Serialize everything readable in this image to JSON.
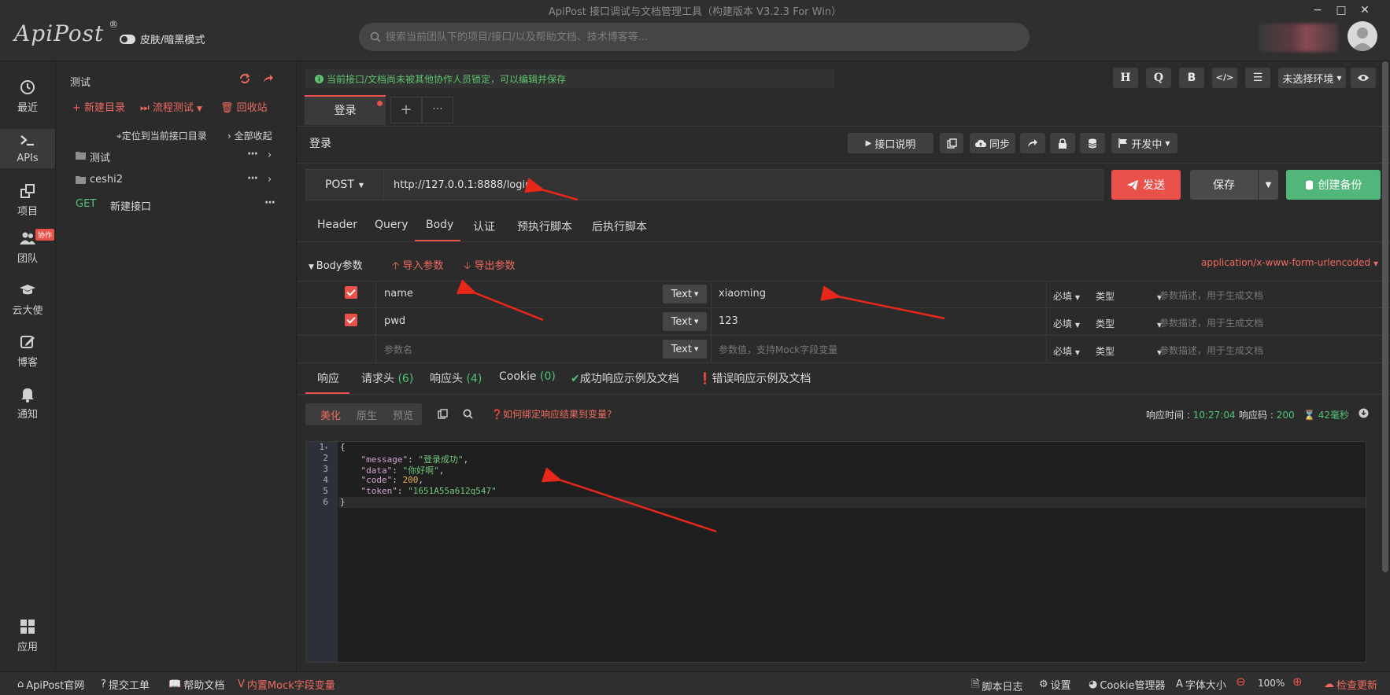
{
  "window": {
    "title": "ApiPost 接口调试与文档管理工具（构建版本 V3.2.3 For Win）",
    "logo": "ApiPost",
    "logo_mark": "®",
    "skin_toggle_label": "皮肤/暗黑模式",
    "search_placeholder": "搜索当前团队下的项目/接口/以及帮助文档、技术博客等...",
    "controls": {
      "minimize": "−",
      "maximize": "□",
      "close": "✕"
    }
  },
  "leftnav": {
    "items": [
      {
        "label": "最近",
        "icon": "clock-icon"
      },
      {
        "label": "APIs",
        "icon": "terminal-icon"
      },
      {
        "label": "项目",
        "icon": "project-icon"
      },
      {
        "label": "团队",
        "icon": "team-icon"
      },
      {
        "label": "云大使",
        "icon": "graduation-cap-icon"
      },
      {
        "label": "博客",
        "icon": "edit-icon"
      },
      {
        "label": "通知",
        "icon": "bell-icon"
      },
      {
        "label": "应用",
        "icon": "grid-icon"
      }
    ],
    "collab_badge": "协作"
  },
  "tree": {
    "project_title": "测试",
    "new_dir": "新建目录",
    "flow_test": "流程测试",
    "recycle": "回收站",
    "locate": "定位到当前接口目录",
    "collapse_all": "全部收起",
    "nodes": [
      {
        "type": "folder",
        "label": "测试"
      },
      {
        "type": "folder",
        "label": "ceshi2"
      },
      {
        "type": "api",
        "method": "GET",
        "label": "新建接口"
      }
    ]
  },
  "main": {
    "lock_note": "当前接口/文档尚未被其他协作人员锁定，可以编辑并保存",
    "toolbar": {
      "h": "H",
      "q": "Q",
      "b": "B",
      "code": "</>",
      "filter": "☰"
    },
    "env_select": "未选择环境",
    "tabs": [
      {
        "label": "登录"
      }
    ],
    "tab_add": "+",
    "tab_more": "···",
    "api_name": "登录",
    "doc_btn": "接口说明",
    "sync_btn": "同步",
    "status_btn": "开发中",
    "method": "POST",
    "url": "http://127.0.0.1:8888/login",
    "send": "发送",
    "save": "保存",
    "backup": "创建备份",
    "req_tabs": [
      "Header",
      "Query",
      "Body",
      "认证",
      "预执行脚本",
      "后执行脚本"
    ],
    "body_params_label": "Body参数",
    "import_params": "导入参数",
    "export_params": "导出参数",
    "content_type": "application/x-www-form-urlencoded",
    "params": [
      {
        "name": "name",
        "type": "Text",
        "value": "xiaoming",
        "required": "必填",
        "dtype": "类型",
        "desc_placeholder": "参数描述，用于生成文档"
      },
      {
        "name": "pwd",
        "type": "Text",
        "value": "123",
        "required": "必填",
        "dtype": "类型",
        "desc_placeholder": "参数描述，用于生成文档"
      },
      {
        "name_placeholder": "参数名",
        "type": "Text",
        "value_placeholder": "参数值，支持Mock字段变量",
        "required": "必填",
        "dtype": "类型",
        "desc_placeholder": "参数描述，用于生成文档"
      }
    ],
    "resp_tabs": {
      "response": "响应",
      "req_headers": "请求头",
      "req_headers_count": "(6)",
      "resp_headers": "响应头",
      "resp_headers_count": "(4)",
      "cookie": "Cookie",
      "cookie_count": "(0)",
      "success_doc": "成功响应示例及文档",
      "error_doc": "错误响应示例及文档"
    },
    "view_modes": [
      "美化",
      "原生",
      "预览"
    ],
    "bind_help": "如何绑定响应结果到变量?",
    "resp_time_label": "响应时间 :",
    "resp_time": "10:27:04",
    "resp_code_label": "响应码 :",
    "resp_code": "200",
    "resp_duration": "42毫秒",
    "code_lines": [
      {
        "no": "1",
        "fold": "▾"
      },
      {
        "no": "2"
      },
      {
        "no": "3"
      },
      {
        "no": "4"
      },
      {
        "no": "5"
      },
      {
        "no": "6"
      }
    ],
    "json": {
      "open": "{",
      "k_message": "\"message\"",
      "v_message": "\"登录成功\"",
      "k_data": "\"data\"",
      "v_data": "\"你好啊\"",
      "k_code": "\"code\"",
      "v_code": "200",
      "k_token": "\"token\"",
      "v_token": "\"1651A55a612q547\"",
      "close": "}"
    }
  },
  "statusbar": {
    "official": "ApiPost官网",
    "ticket": "提交工单",
    "help": "帮助文档",
    "mock": "内置Mock字段变量",
    "script_log": "脚本日志",
    "settings": "设置",
    "cookie_mgr": "Cookie管理器",
    "font_size": "字体大小",
    "zoom": "100%",
    "check_update": "检查更新"
  },
  "colors": {
    "accent": "#e9524a",
    "success": "#52b57a",
    "bg": "#2b2b2b"
  }
}
